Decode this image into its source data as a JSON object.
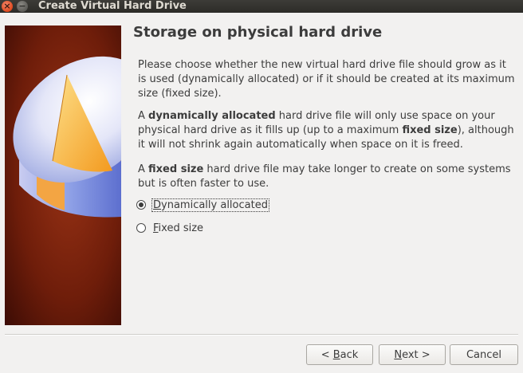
{
  "window": {
    "title": "Create Virtual Hard Drive",
    "close_glyph": "×",
    "minimize_glyph": "−"
  },
  "page": {
    "title": "Storage on physical hard drive",
    "paragraph1": "Please choose whether the new virtual hard drive file should grow as it is used (dynamically allocated) or if it should be created at its maximum size (fixed size).",
    "paragraph2": {
      "t1": "A ",
      "b1": "dynamically allocated",
      "t2": " hard drive file will only use space on your physical hard drive as it fills up (up to a maximum ",
      "b2": "fixed size",
      "t3": "), although it will not shrink again automatically when space on it is freed."
    },
    "paragraph3": {
      "t1": "A ",
      "b1": "fixed size",
      "t2": " hard drive file may take longer to create on some systems but is often faster to use."
    }
  },
  "options": [
    {
      "mnemonic": "D",
      "rest": "ynamically allocated",
      "selected": true
    },
    {
      "mnemonic": "F",
      "rest": "ixed size",
      "selected": false
    }
  ],
  "buttons": {
    "back": {
      "lead": "< ",
      "mnemonic": "B",
      "rest": "ack"
    },
    "next": {
      "mnemonic": "N",
      "rest": "ext >"
    },
    "cancel": {
      "label": "Cancel"
    }
  },
  "icons": {
    "close": "close-icon",
    "minimize": "minimize-icon",
    "wizard_image": "hard-drive-pie-icon"
  },
  "colors": {
    "panel_dark": "#3a0c04",
    "panel_red": "#8e2a12",
    "disk_slice": "#f7a832",
    "disk_side": "#8ea0e6"
  }
}
